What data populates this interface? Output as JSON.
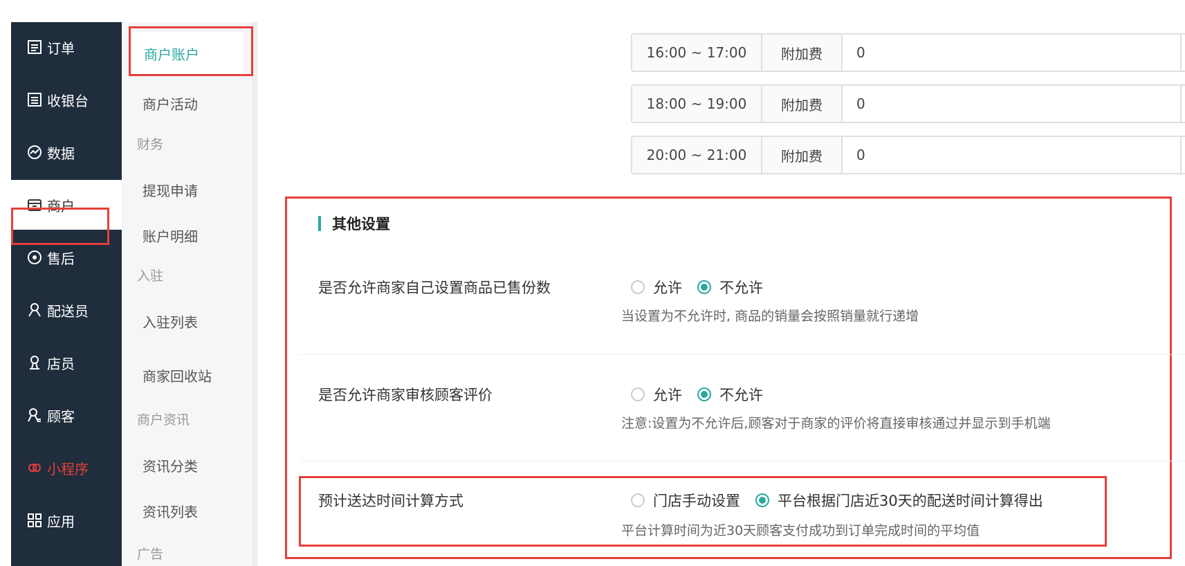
{
  "sidebar_main": {
    "items": [
      {
        "label": "订单",
        "icon": "order-list-icon"
      },
      {
        "label": "收银台",
        "icon": "cashier-icon"
      },
      {
        "label": "数据",
        "icon": "data-chart-icon"
      },
      {
        "label": "商户",
        "icon": "store-icon"
      },
      {
        "label": "售后",
        "icon": "after-sales-icon"
      },
      {
        "label": "配送员",
        "icon": "courier-icon"
      },
      {
        "label": "店员",
        "icon": "clerk-icon"
      },
      {
        "label": "顾客",
        "icon": "customer-icon"
      },
      {
        "label": "小程序",
        "icon": "mini-program-icon"
      },
      {
        "label": "应用",
        "icon": "apps-icon"
      }
    ]
  },
  "sidebar_sub": {
    "account": "商户账户",
    "activity": "商户活动",
    "group_finance": "财务",
    "withdraw": "提现申请",
    "account_detail": "账户明细",
    "group_settle": "入驻",
    "settle_list": "入驻列表",
    "recycle": "商家回收站",
    "group_news": "商户资讯",
    "news_category": "资讯分类",
    "news_list": "资讯列表",
    "group_ads": "广告"
  },
  "time_rows": [
    {
      "range": "16:00 ~ 17:00",
      "label": "附加费",
      "value": "0"
    },
    {
      "range": "18:00 ~ 19:00",
      "label": "附加费",
      "value": "0"
    },
    {
      "range": "20:00 ~ 21:00",
      "label": "附加费",
      "value": "0"
    }
  ],
  "other_settings": {
    "title": "其他设置",
    "sold_count": {
      "label": "是否允许商家自己设置商品已售份数",
      "options": [
        "允许",
        "不允许"
      ],
      "selected": "不允许",
      "hint": "当设置为不允许时, 商品的销量会按照销量就行递增"
    },
    "review": {
      "label": "是否允许商家审核顾客评价",
      "options": [
        "允许",
        "不允许"
      ],
      "selected": "不允许",
      "hint": "注意:设置为不允许后,顾客对于商家的评价将直接审核通过并显示到手机端"
    },
    "delivery_time": {
      "label": "预计送达时间计算方式",
      "options": [
        "门店手动设置",
        "平台根据门店近30天的配送时间计算得出"
      ],
      "selected": "平台根据门店近30天的配送时间计算得出",
      "hint": "平台计算时间为近30天顾客支付成功到订单完成时间的平均值"
    }
  },
  "colors": {
    "accent": "#2aa8a0",
    "sidebar": "#1f2d3d",
    "highlight": "#e5403a"
  }
}
